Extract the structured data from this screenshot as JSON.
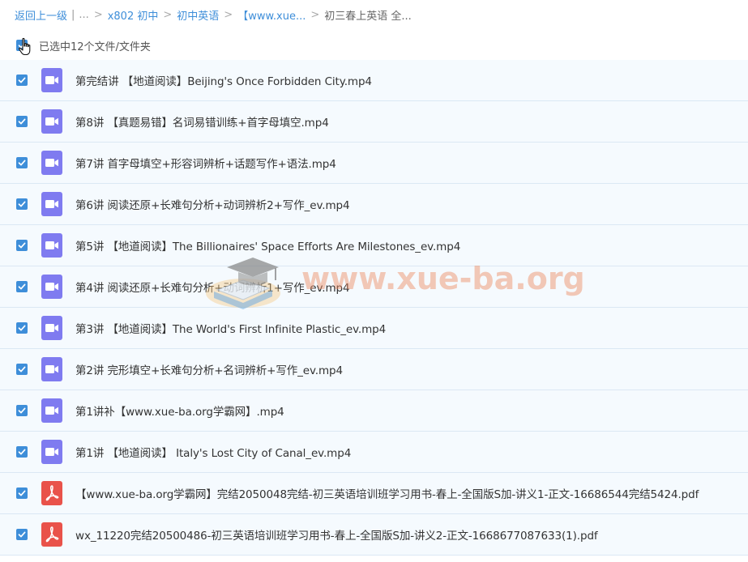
{
  "breadcrumb": {
    "back": "返回上一级",
    "divider": "|",
    "ellipsis": "...",
    "sep": ">",
    "items": [
      "x802 初中",
      "初中英语",
      "【www.xue..."
    ],
    "current": "初三春上英语 全..."
  },
  "selection": {
    "label": "已选中12个文件/文件夹"
  },
  "files": [
    {
      "name": "第完结讲 【地道阅读】Beijing's Once Forbidden City.mp4",
      "type": "video",
      "icon": "video-icon"
    },
    {
      "name": "第8讲 【真题易错】名词易错训练+首字母填空.mp4",
      "type": "video",
      "icon": "video-icon"
    },
    {
      "name": "第7讲 首字母填空+形容词辨析+话题写作+语法.mp4",
      "type": "video",
      "icon": "video-icon"
    },
    {
      "name": "第6讲 阅读还原+长难句分析+动词辨析2+写作_ev.mp4",
      "type": "video",
      "icon": "video-icon"
    },
    {
      "name": "第5讲 【地道阅读】The Billionaires' Space Efforts Are Milestones_ev.mp4",
      "type": "video",
      "icon": "video-icon"
    },
    {
      "name": "第4讲 阅读还原+长难句分析+动词辨析1+写作_ev.mp4",
      "type": "video",
      "icon": "video-icon"
    },
    {
      "name": "第3讲 【地道阅读】The World's First Infinite Plastic_ev.mp4",
      "type": "video",
      "icon": "video-icon"
    },
    {
      "name": "第2讲 完形填空+长难句分析+名词辨析+写作_ev.mp4",
      "type": "video",
      "icon": "video-icon"
    },
    {
      "name": "第1讲补【www.xue-ba.org学霸网】.mp4",
      "type": "video",
      "icon": "video-icon"
    },
    {
      "name": "第1讲 【地道阅读】 Italy's Lost City of Canal_ev.mp4",
      "type": "video",
      "icon": "video-icon"
    },
    {
      "name": "【www.xue-ba.org学霸网】完结2050048完结-初三英语培训班学习用书-春上-全国版S加-讲义1-正文-16686544完结5424.pdf",
      "type": "pdf",
      "icon": "pdf-icon"
    },
    {
      "name": "wx_11220完结20500486-初三英语培训班学习用书-春上-全国版S加-讲义2-正文-1668677087633(1).pdf",
      "type": "pdf",
      "icon": "pdf-icon"
    }
  ],
  "watermark": {
    "text": "www.xue-ba.org",
    "icon": "graduation-cap-book-icon"
  },
  "colors": {
    "accent": "#3e8ed9",
    "video_icon": "#7f7bf0",
    "pdf_icon": "#e9524a",
    "row_bg": "#f5fafe",
    "row_border": "#dbe8f4"
  }
}
